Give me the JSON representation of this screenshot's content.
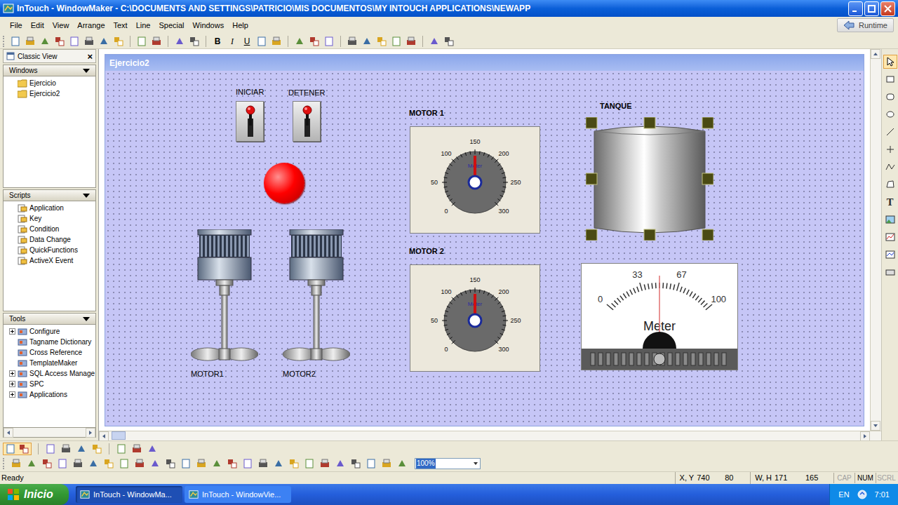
{
  "window": {
    "title": "InTouch - WindowMaker - C:\\DOCUMENTS AND SETTINGS\\PATRICIO\\MIS DOCUMENTOS\\MY INTOUCH APPLICATIONS\\NEWAPP"
  },
  "menu": [
    "File",
    "Edit",
    "View",
    "Arrange",
    "Text",
    "Line",
    "Special",
    "Windows",
    "Help"
  ],
  "runtime_button": "Runtime",
  "toolbar": {
    "format_buttons": [
      "B",
      "I",
      "U"
    ]
  },
  "classic_view": {
    "title": "Classic View",
    "close": "×"
  },
  "sections": [
    {
      "title": "Windows",
      "kind": "folder",
      "items": [
        {
          "label": "Ejercicio",
          "expandable": false
        },
        {
          "label": "Ejercicio2",
          "expandable": false
        }
      ]
    },
    {
      "title": "Scripts",
      "kind": "script",
      "items": [
        {
          "label": "Application",
          "expandable": false
        },
        {
          "label": "Key",
          "expandable": false
        },
        {
          "label": "Condition",
          "expandable": false
        },
        {
          "label": "Data Change",
          "expandable": false
        },
        {
          "label": "QuickFunctions",
          "expandable": false
        },
        {
          "label": "ActiveX Event",
          "expandable": false
        }
      ]
    },
    {
      "title": "Tools",
      "kind": "tool",
      "items": [
        {
          "label": "Configure",
          "expandable": true
        },
        {
          "label": "Tagname Dictionary",
          "expandable": false
        },
        {
          "label": "Cross Reference",
          "expandable": false
        },
        {
          "label": "TemplateMaker",
          "expandable": false
        },
        {
          "label": "SQL Access Manage",
          "expandable": true
        },
        {
          "label": "SPC",
          "expandable": true
        },
        {
          "label": "Applications",
          "expandable": true
        }
      ]
    }
  ],
  "canvas_window": {
    "title": "Ejercicio2"
  },
  "switches": [
    {
      "label": "INICIAR",
      "on": false
    },
    {
      "label": "DETENER",
      "on": false
    }
  ],
  "lamp": {
    "on": true
  },
  "motors": [
    {
      "label": "MOTOR1"
    },
    {
      "label": "MOTOR2"
    }
  ],
  "gauges": [
    {
      "label": "MOTOR 1",
      "name": "Meter",
      "ticks": [
        "0",
        "50",
        "100",
        "150",
        "200",
        "250",
        "300"
      ],
      "level": 0.5
    },
    {
      "label": "MOTOR 2",
      "name": "Meter",
      "ticks": [
        "0",
        "50",
        "100",
        "150",
        "200",
        "250",
        "300"
      ],
      "level": 0.5
    }
  ],
  "tank": {
    "label": "TANQUE",
    "selected": true
  },
  "meter": {
    "name": "Meter",
    "ticks": [
      "0",
      "33",
      "67",
      "100"
    ],
    "level": 0.5
  },
  "right_tools": [
    {
      "kind": "pointer",
      "selected": true
    },
    {
      "kind": "rectangle",
      "selected": false
    },
    {
      "kind": "rounded",
      "selected": false
    },
    {
      "kind": "ellipse",
      "selected": false
    },
    {
      "kind": "line",
      "selected": false
    },
    {
      "kind": "hvline",
      "selected": false
    },
    {
      "kind": "polyline",
      "selected": false
    },
    {
      "kind": "polygon",
      "selected": false
    },
    {
      "kind": "text",
      "selected": false,
      "label": "T"
    },
    {
      "kind": "bitmap",
      "selected": false
    },
    {
      "kind": "trend",
      "selected": false
    },
    {
      "kind": "history",
      "selected": false
    },
    {
      "kind": "button",
      "selected": false
    }
  ],
  "zoom": "100%",
  "status_bar": {
    "text": "Ready",
    "xy_label": "X, Y",
    "x": "740",
    "y": "80",
    "wh_label": "W, H",
    "w": "171",
    "h": "165",
    "indicators": [
      {
        "label": "CAP",
        "on": false
      },
      {
        "label": "NUM",
        "on": true
      },
      {
        "label": "SCRL",
        "on": false
      }
    ]
  },
  "taskbar": {
    "start": "Inicio",
    "tasks": [
      {
        "label": "InTouch - WindowMa...",
        "selected": true
      },
      {
        "label": "InTouch - WindowVie...",
        "selected": false
      }
    ],
    "language": "EN",
    "time": "7:01"
  }
}
